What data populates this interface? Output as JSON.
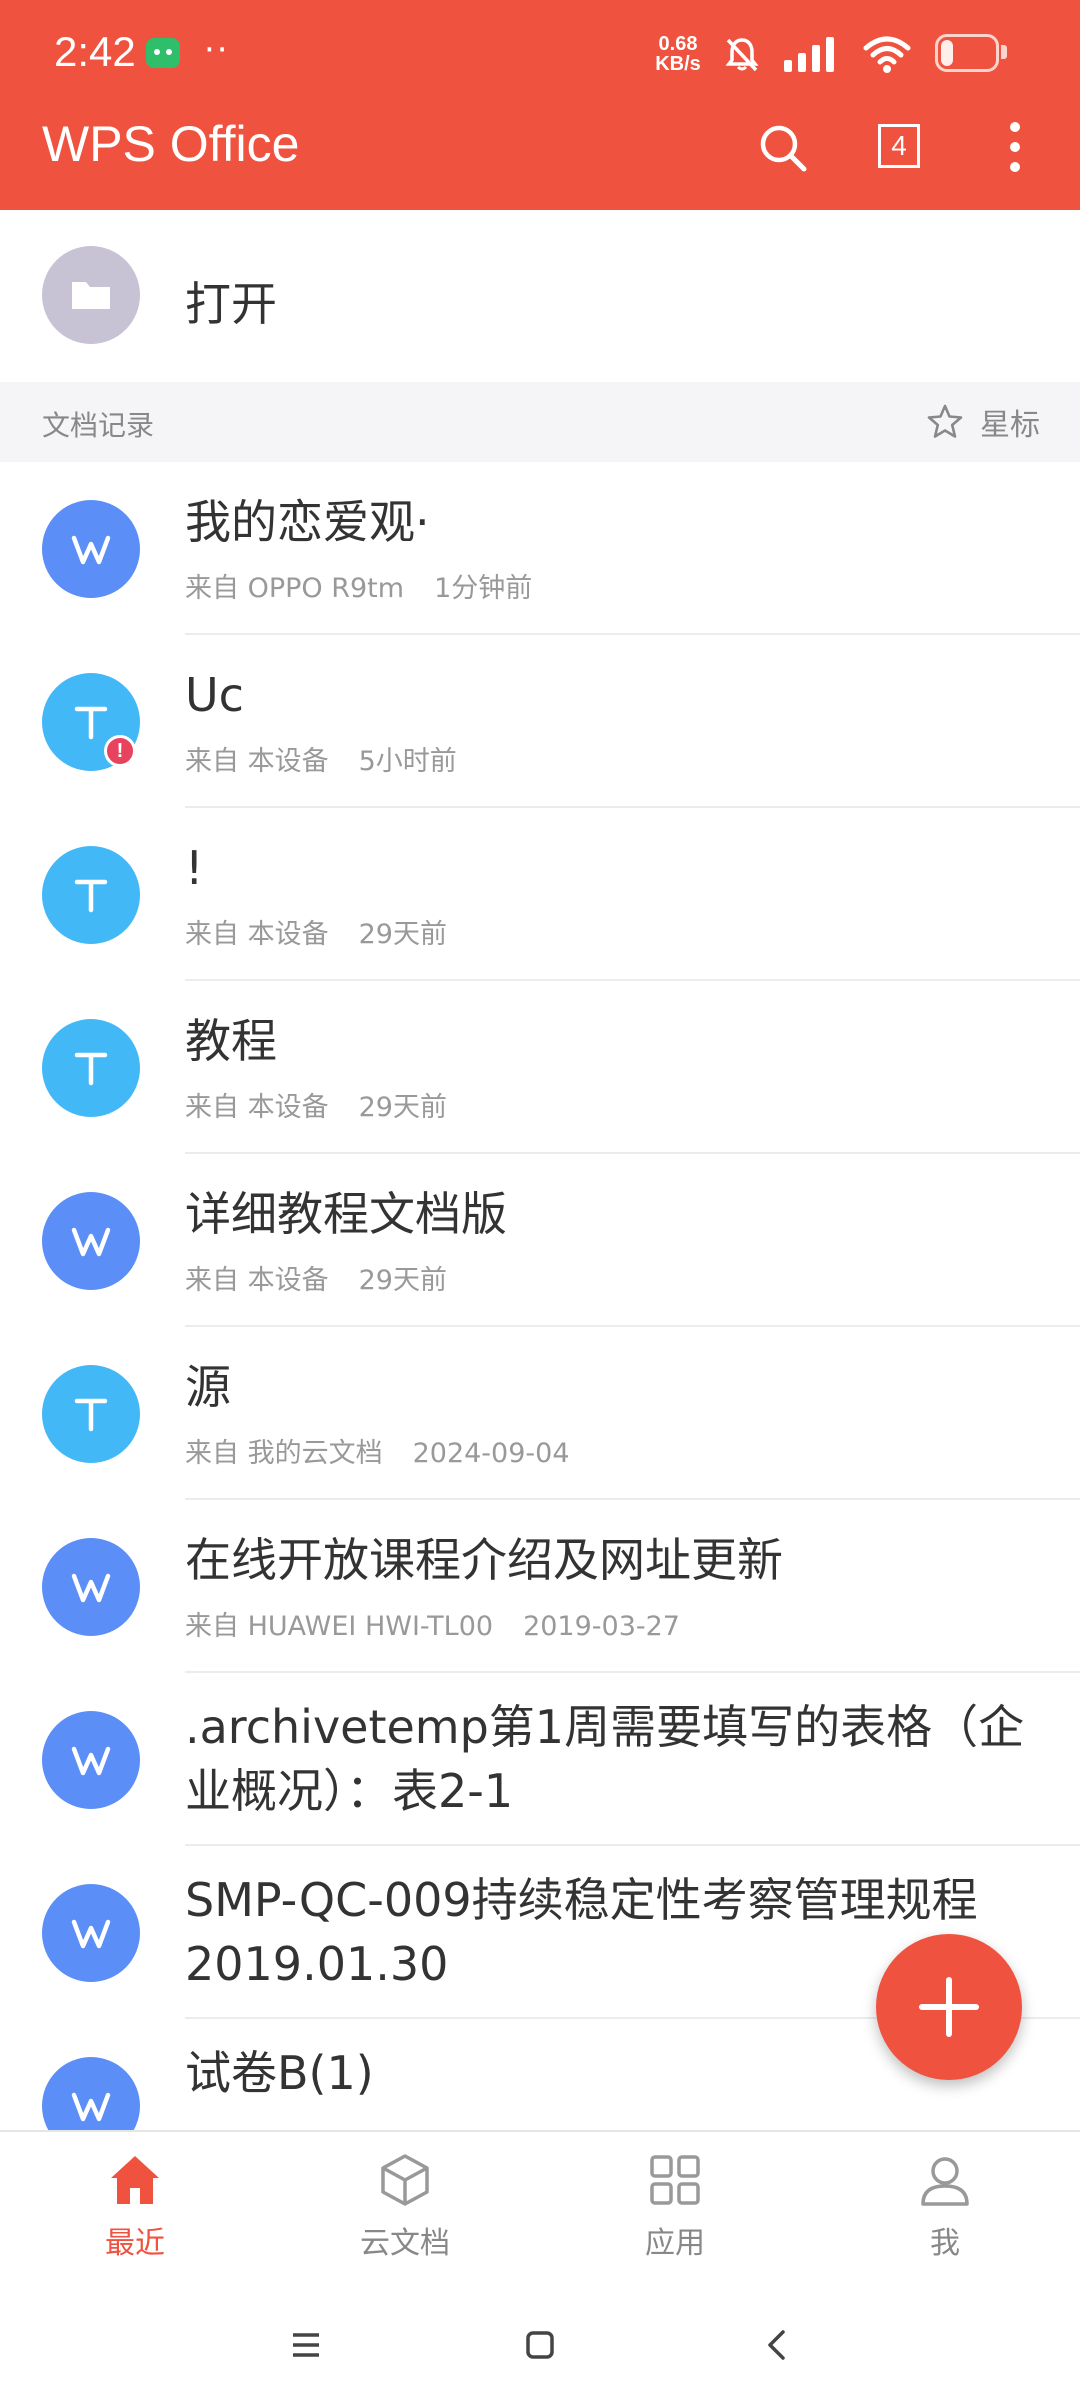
{
  "status_bar": {
    "time": "2:42",
    "extra_dots": "··",
    "net_speed_value": "0.68",
    "net_speed_unit": "KB/s",
    "battery_level": "23"
  },
  "app_bar": {
    "title": "WPS Office",
    "tab_count": "4"
  },
  "open_row": {
    "label": "打开"
  },
  "section": {
    "label": "文档记录",
    "star_label": "星标"
  },
  "documents": [
    {
      "title": "我的恋爱观·",
      "source": "来自 OPPO R9tm",
      "time": "1分钟前",
      "type": "W"
    },
    {
      "title": "Uc",
      "source": "来自 本设备",
      "time": "5小时前",
      "type": "T",
      "badge": "!"
    },
    {
      "title": "!",
      "source": "来自 本设备",
      "time": "29天前",
      "type": "T"
    },
    {
      "title": "教程",
      "source": "来自 本设备",
      "time": "29天前",
      "type": "T"
    },
    {
      "title": "详细教程文档版",
      "source": "来自 本设备",
      "time": "29天前",
      "type": "W"
    },
    {
      "title": "源",
      "source": "来自 我的云文档",
      "time": "2024-09-04",
      "type": "T"
    },
    {
      "title": "在线开放课程介绍及网址更新",
      "source": "来自 HUAWEI HWI-TL00",
      "time": "2019-03-27",
      "type": "W"
    },
    {
      "title": ".archivetemp第1周需要填写的表格（企业概况）：表2-1",
      "type": "W"
    },
    {
      "title": "SMP-QC-009持续稳定性考察管理规程2019.01.30",
      "type": "W"
    },
    {
      "title": "试卷B(1)",
      "type": "W"
    }
  ],
  "bottom_nav": [
    {
      "label": "最近",
      "icon": "home-icon",
      "active": true
    },
    {
      "label": "云文档",
      "icon": "cloud-box-icon",
      "active": false
    },
    {
      "label": "应用",
      "icon": "apps-grid-icon",
      "active": false
    },
    {
      "label": "我",
      "icon": "person-icon",
      "active": false
    }
  ],
  "colors": {
    "brand": "#ef533f",
    "writer_blue": "#5b8ef7",
    "text_blue": "#43b8f7",
    "folder_gray": "#c7c3d5",
    "alert_red": "#e8435e"
  }
}
